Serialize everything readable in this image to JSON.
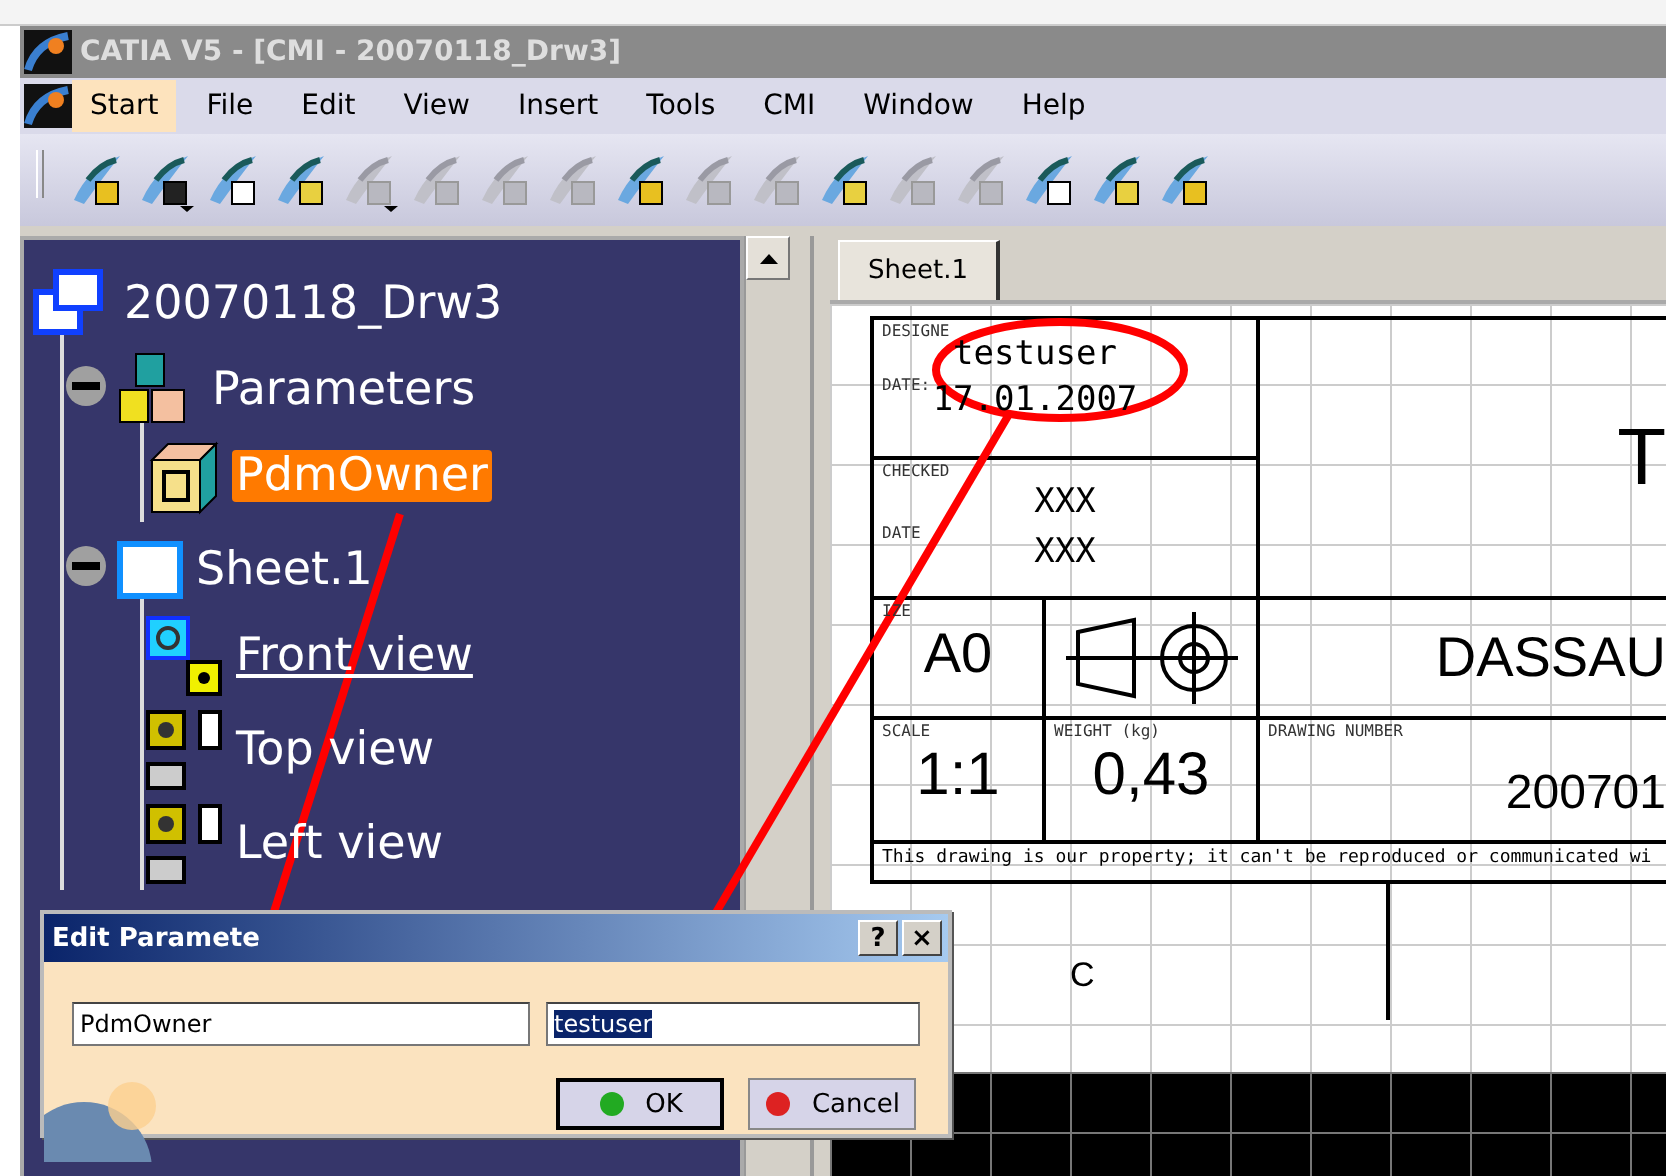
{
  "window": {
    "title": "CATIA V5 - [CMI - 20070118_Drw3]"
  },
  "menu": [
    {
      "label": "Start",
      "selected": true
    },
    {
      "label": "File",
      "selected": false
    },
    {
      "label": "Edit",
      "selected": false
    },
    {
      "label": "View",
      "selected": false
    },
    {
      "label": "Insert",
      "selected": false
    },
    {
      "label": "Tools",
      "selected": false
    },
    {
      "label": "CMI",
      "selected": false
    },
    {
      "label": "Window",
      "selected": false
    },
    {
      "label": "Help",
      "selected": false
    }
  ],
  "toolbar": [
    {
      "disabled": false,
      "dropdown": false
    },
    {
      "disabled": false,
      "dropdown": true
    },
    {
      "disabled": false,
      "dropdown": false
    },
    {
      "disabled": false,
      "dropdown": false
    },
    {
      "disabled": true,
      "dropdown": true
    },
    {
      "disabled": true,
      "dropdown": false
    },
    {
      "disabled": true,
      "dropdown": false
    },
    {
      "disabled": true,
      "dropdown": false
    },
    {
      "disabled": false,
      "dropdown": false
    },
    {
      "disabled": true,
      "dropdown": false
    },
    {
      "disabled": true,
      "dropdown": false
    },
    {
      "disabled": false,
      "dropdown": false
    },
    {
      "disabled": true,
      "dropdown": false
    },
    {
      "disabled": true,
      "dropdown": false
    },
    {
      "disabled": false,
      "dropdown": false
    },
    {
      "disabled": false,
      "dropdown": false
    },
    {
      "disabled": false,
      "dropdown": false
    }
  ],
  "tree": {
    "label": "20070118_Drw3",
    "kind": "drawing",
    "selected": false,
    "expanded": true,
    "children": [
      {
        "label": "Parameters",
        "kind": "parameters",
        "selected": false,
        "expanded": true,
        "children": [
          {
            "label": "PdmOwner",
            "kind": "parameter",
            "selected": true
          }
        ]
      },
      {
        "label": "Sheet.1",
        "kind": "sheet",
        "selected": false,
        "expanded": true,
        "children": [
          {
            "label": "Front view",
            "kind": "front-view",
            "selected": false,
            "active": true
          },
          {
            "label": "Top view",
            "kind": "view",
            "selected": false,
            "active": false
          },
          {
            "label": "Left view",
            "kind": "view",
            "selected": false,
            "active": false
          }
        ]
      }
    ]
  },
  "drawing": {
    "tabs": [
      {
        "label": "Sheet.1",
        "selected": true
      }
    ],
    "title_block": {
      "designed_by_label": "DESIGNE",
      "designed_by": "testuser",
      "date_label": "DATE:",
      "date": "17.01.2007",
      "checked_by_label": "CHECKED",
      "checked_by": "XXX",
      "checked_date_label": "DATE",
      "checked_date": "XXX",
      "title": "T",
      "size_label": "IZE",
      "size": "A0",
      "company": "DASSAU",
      "scale_label": "SCALE",
      "scale": "1:1",
      "weight_label": "WEIGHT (kg)",
      "weight": "0,43",
      "drawing_number_label": "DRAWING NUMBER",
      "drawing_number": "200701",
      "note": "This drawing is our property; it can't be reproduced or communicated wi"
    },
    "revision_cell": "C"
  },
  "dialog": {
    "title": "Edit Paramete",
    "title_buttons": [
      "?",
      "×"
    ],
    "name_field": {
      "value": "PdmOwner"
    },
    "value_field": {
      "value": "testuser",
      "text_selected": true
    },
    "buttons": [
      {
        "label": "OK",
        "kind": "ok",
        "default": true
      },
      {
        "label": "Cancel",
        "kind": "cancel",
        "default": false
      }
    ]
  }
}
